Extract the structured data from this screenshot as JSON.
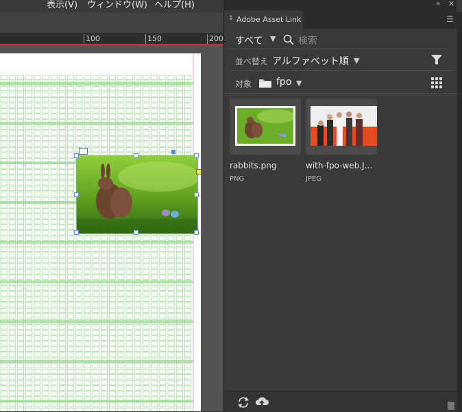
{
  "menubar": {
    "items": [
      "表示(V)",
      "ウィンドウ(W)",
      "ヘルプ(H)"
    ]
  },
  "ruler": {
    "labels": [
      "100",
      "150",
      "200"
    ]
  },
  "panel": {
    "tab_title": "Adobe Asset Link",
    "filter_type": "すべて",
    "search_placeholder": "検索",
    "sort_label": "並べ替え",
    "sort_value": "アルファベット順",
    "target_label": "対象",
    "target_folder": "fpo",
    "assets": [
      {
        "name": "rabbits.png",
        "type": "PNG"
      },
      {
        "name": "with-fpo-web.J...",
        "type": "JPEG"
      }
    ]
  },
  "icons": {
    "collapse": "double-chevron-left-icon",
    "close": "close-icon",
    "panel_menu": "hamburger-icon",
    "search": "search-icon",
    "filter": "funnel-icon",
    "folder": "folder-icon",
    "grid_view": "grid-view-icon",
    "refresh": "refresh-icon",
    "upload": "cloud-upload-icon"
  },
  "colors": {
    "panel_bg": "#393939",
    "grid_green": "#97d98f",
    "selection_blue": "#5b8fd8",
    "page_white": "#ffffff"
  }
}
